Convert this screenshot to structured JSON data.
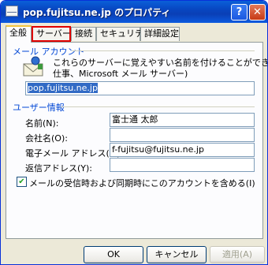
{
  "window": {
    "title": "pop.fujitsu.ne.jp のプロパティ"
  },
  "tabs": [
    {
      "label": "全般"
    },
    {
      "label": "サーバー"
    },
    {
      "label": "接続"
    },
    {
      "label": "セキュリティ"
    },
    {
      "label": "詳細設定"
    }
  ],
  "mail_account": {
    "section_label": "メール アカウント",
    "description_line1": "これらのサーバーに覚えやすい名前を付けることができます。(例 :",
    "description_line2": "仕事、Microsoft メール サーバー)",
    "account_name": "pop.fujitsu.ne.jp"
  },
  "user_info": {
    "section_label": "ユーザー情報",
    "name_label": "名前(N):",
    "name_value": "富士通 太郎",
    "company_label": "会社名(O):",
    "company_value": "",
    "email_label": "電子メール アドレス(M):",
    "email_value": "f-fujitsu@fujitsu.ne.jp",
    "reply_label": "返信アドレス(Y):",
    "reply_value": ""
  },
  "checkbox": {
    "label": "メールの受信時および同期時にこのアカウントを含める(I)",
    "checked": true
  },
  "buttons": {
    "ok": "OK",
    "cancel": "キャンセル",
    "apply": "適用(A)"
  },
  "colors": {
    "highlight_box": "#e00000",
    "titlebar": "#0a46c1"
  }
}
